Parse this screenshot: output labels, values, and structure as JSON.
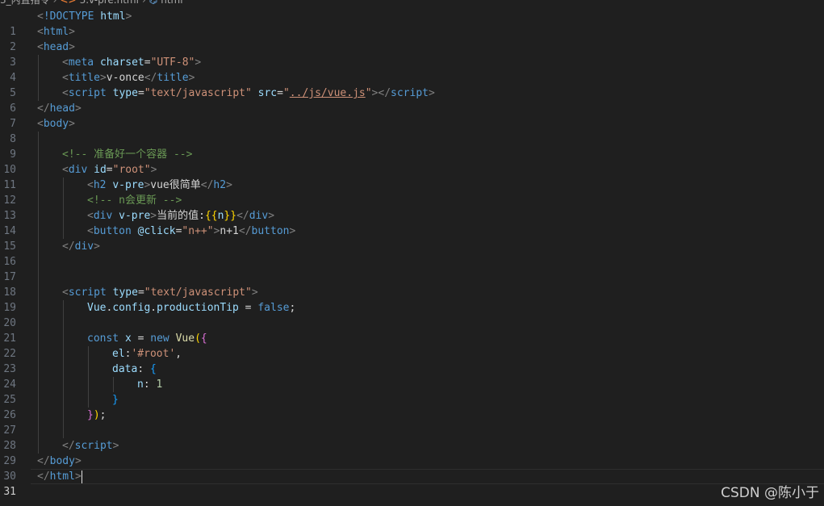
{
  "breadcrumb": {
    "folder": "3_内置指令",
    "file": "3.v-pre.html",
    "element": "html"
  },
  "editor": {
    "current_line": 31,
    "lines": [
      {
        "n": "1"
      },
      {
        "n": "2"
      },
      {
        "n": "3"
      },
      {
        "n": "4"
      },
      {
        "n": "5"
      },
      {
        "n": "6"
      },
      {
        "n": "7"
      },
      {
        "n": "8"
      },
      {
        "n": "9"
      },
      {
        "n": "10"
      },
      {
        "n": "11"
      },
      {
        "n": "12"
      },
      {
        "n": "13"
      },
      {
        "n": "14"
      },
      {
        "n": "15"
      },
      {
        "n": "16"
      },
      {
        "n": "17"
      },
      {
        "n": "18"
      },
      {
        "n": "19"
      },
      {
        "n": "20"
      },
      {
        "n": "21"
      },
      {
        "n": "22"
      },
      {
        "n": "23"
      },
      {
        "n": "24"
      },
      {
        "n": "25"
      },
      {
        "n": "26"
      },
      {
        "n": "27"
      },
      {
        "n": "28"
      },
      {
        "n": "29"
      },
      {
        "n": "30"
      },
      {
        "n": "31"
      }
    ],
    "tokens": {
      "doctype": "!DOCTYPE",
      "html_kw": "html",
      "html": "html",
      "head": "head",
      "meta": "meta",
      "charset": "charset",
      "utf8": "\"UTF-8\"",
      "title": "title",
      "title_text": "v-once",
      "script": "script",
      "type": "type",
      "js_type": "\"text/javascript\"",
      "src": "src",
      "src_val": "../js/vue.js",
      "body": "body",
      "comment1": "<!-- 准备好一个容器 -->",
      "div": "div",
      "id": "id",
      "root": "\"root\"",
      "h2": "h2",
      "vpre": "v-pre",
      "h2_text": "vue很简单",
      "comment2": "<!-- n会更新 -->",
      "div_text": "当前的值:",
      "mustache_open": "{{",
      "mustache_var": "n",
      "mustache_close": "}}",
      "button": "button",
      "click": "@click",
      "click_val": "\"n++\"",
      "button_text": "n+1",
      "vue": "Vue",
      "config": "config",
      "productionTip": "productionTip",
      "false_kw": "false",
      "const_kw": "const",
      "x": "x",
      "new_kw": "new",
      "el": "el",
      "root_sel": "'#root'",
      "data": "data",
      "n": "n",
      "one": "1"
    }
  },
  "watermark": "CSDN @陈小于",
  "colors": {
    "background": "#1f1f1f",
    "tag": "#569cd6",
    "attribute": "#9cdcfe",
    "string": "#ce9178",
    "comment": "#6a9955"
  }
}
